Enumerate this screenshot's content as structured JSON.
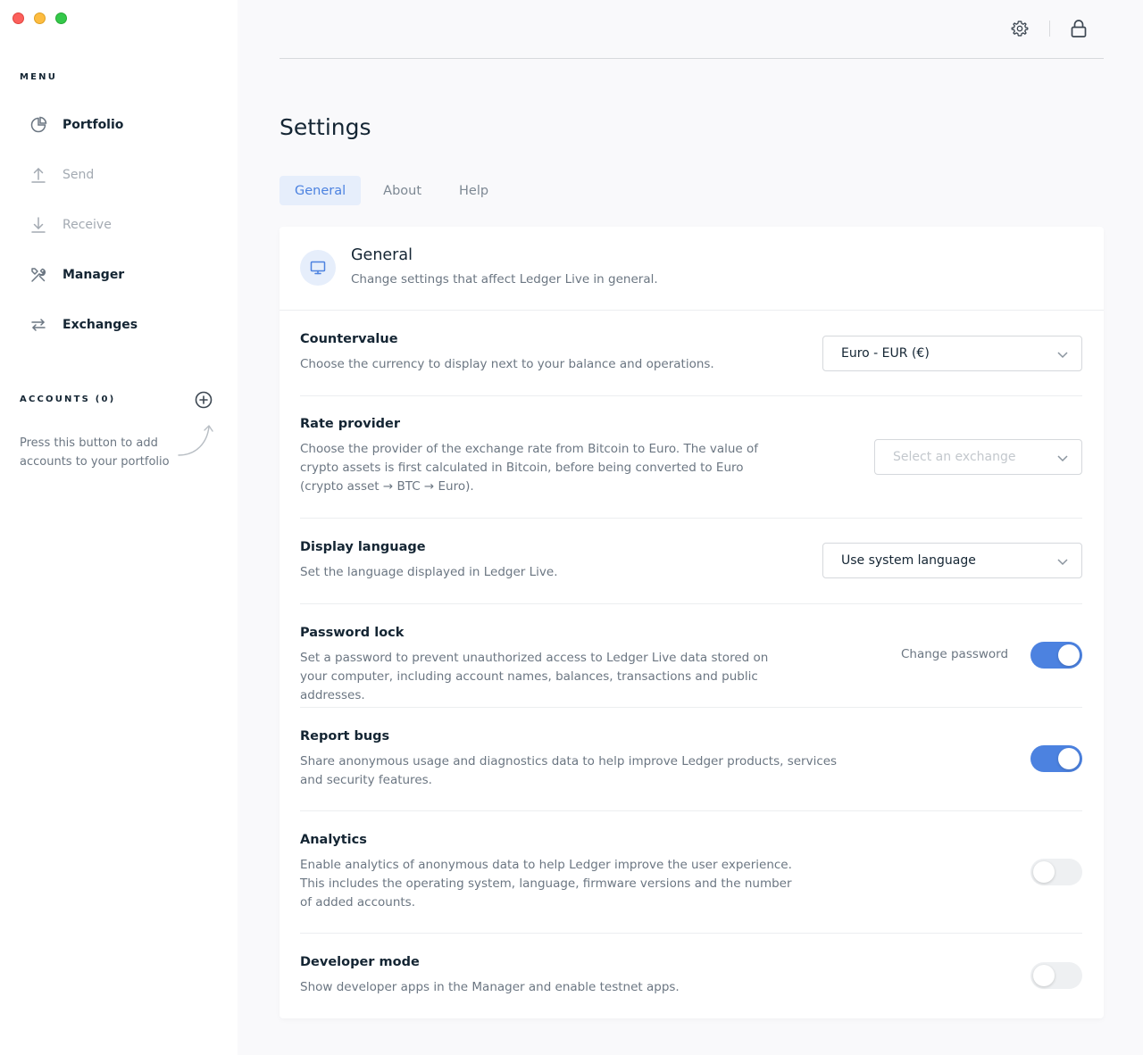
{
  "sidebar": {
    "menu_label": "MENU",
    "items": [
      {
        "label": "Portfolio",
        "icon": "pie-chart-icon",
        "state": "active"
      },
      {
        "label": "Send",
        "icon": "upload-arrow-icon",
        "state": "disabled"
      },
      {
        "label": "Receive",
        "icon": "download-arrow-icon",
        "state": "disabled"
      },
      {
        "label": "Manager",
        "icon": "tools-icon",
        "state": "normal"
      },
      {
        "label": "Exchanges",
        "icon": "swap-arrows-icon",
        "state": "normal"
      }
    ],
    "accounts_label": "ACCOUNTS (0)",
    "accounts_hint": "Press this button to add accounts to your portfolio"
  },
  "topbar": {
    "icons": [
      "gear-icon",
      "lock-icon"
    ]
  },
  "page": {
    "title": "Settings",
    "tabs": [
      {
        "label": "General",
        "active": true
      },
      {
        "label": "About",
        "active": false
      },
      {
        "label": "Help",
        "active": false
      }
    ]
  },
  "section": {
    "title": "General",
    "description": "Change settings that affect Ledger Live in general.",
    "icon": "monitor-icon"
  },
  "settings": {
    "countervalue": {
      "title": "Countervalue",
      "description": "Choose the currency to display next to your balance and operations.",
      "value": "Euro - EUR (€)"
    },
    "rate_provider": {
      "title": "Rate provider",
      "description": "Choose the provider of the exchange rate from Bitcoin to Euro. The value of crypto assets is first calculated in Bitcoin, before being converted to Euro (crypto asset → BTC → Euro).",
      "placeholder": "Select an exchange"
    },
    "display_language": {
      "title": "Display language",
      "description": "Set the language displayed in Ledger Live.",
      "value": "Use system language"
    },
    "password_lock": {
      "title": "Password lock",
      "description": "Set a password to prevent unauthorized access to Ledger Live data stored on your computer, including account names, balances, transactions and public addresses.",
      "link": "Change password",
      "enabled": true
    },
    "report_bugs": {
      "title": "Report bugs",
      "description": "Share anonymous usage and diagnostics data to help improve Ledger products, services and security features.",
      "enabled": true
    },
    "analytics": {
      "title": "Analytics",
      "description": "Enable analytics of anonymous data to help Ledger improve the user experience. This includes the operating system, language, firmware versions and the number of added accounts.",
      "enabled": false
    },
    "developer_mode": {
      "title": "Developer mode",
      "description": "Show developer apps in the Manager and enable testnet apps.",
      "enabled": false
    }
  },
  "colors": {
    "accent": "#4c82e0",
    "accent_light": "#e6eefb",
    "text_primary": "#142533",
    "text_secondary": "#6b7682"
  }
}
